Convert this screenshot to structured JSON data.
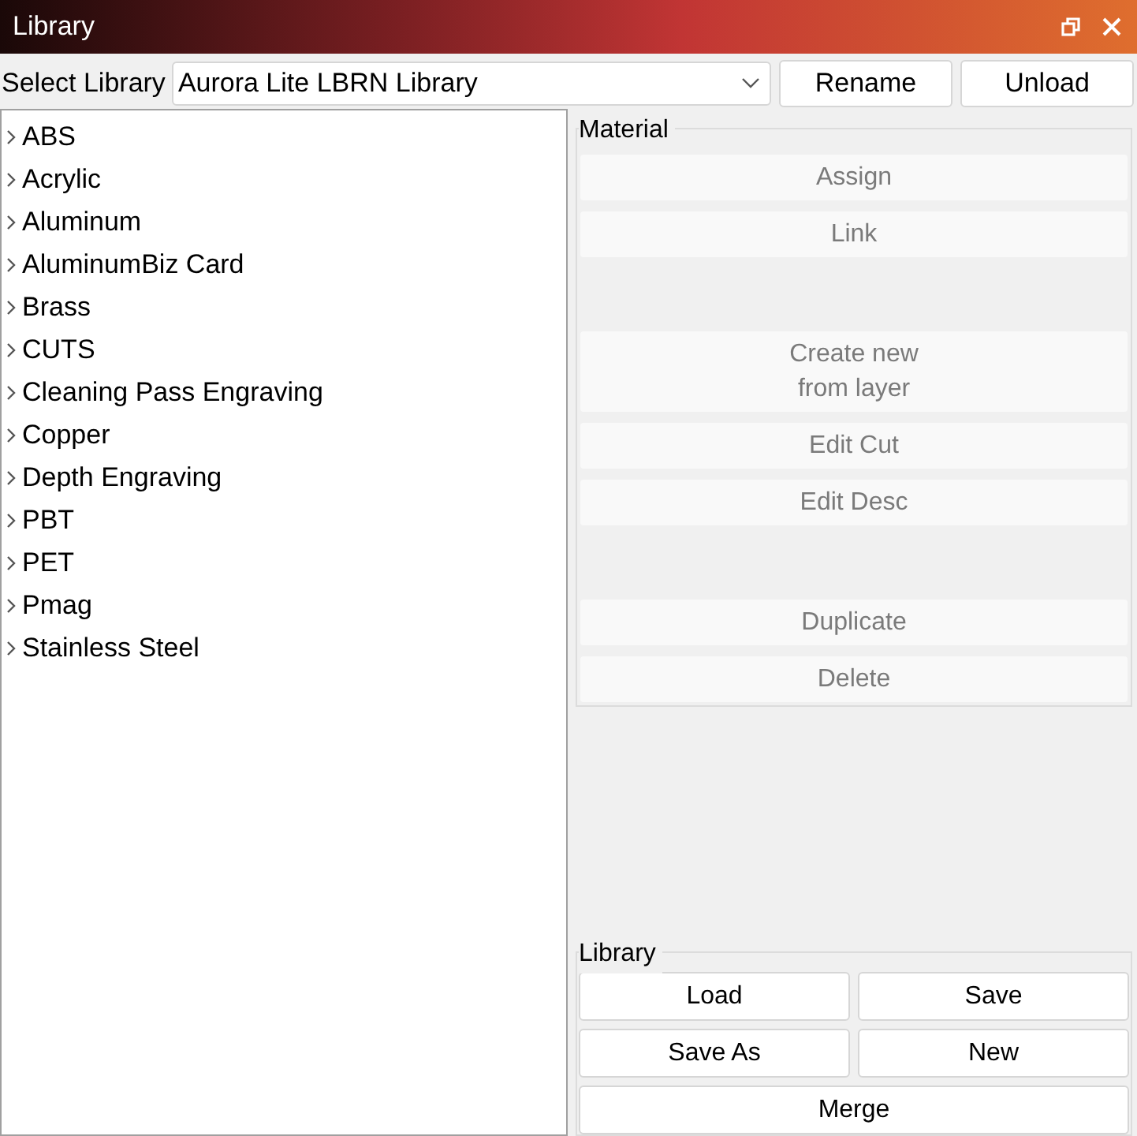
{
  "window": {
    "title": "Library"
  },
  "toolbar": {
    "label": "Select Library",
    "library": "Aurora Lite LBRN Library",
    "buttons": [
      "Rename",
      "Unload"
    ]
  },
  "tree": {
    "items": [
      {
        "label": "ABS",
        "expanded": false
      },
      {
        "label": "Acrylic",
        "expanded": false
      },
      {
        "label": "Aluminum",
        "expanded": false
      },
      {
        "label": "AluminumBiz Card",
        "expanded": false
      },
      {
        "label": "Brass",
        "expanded": false
      },
      {
        "label": "CUTS",
        "expanded": false
      },
      {
        "label": "Cleaning Pass Engraving",
        "expanded": false
      },
      {
        "label": "Copper",
        "expanded": false
      },
      {
        "label": "Depth Engraving",
        "expanded": false
      },
      {
        "label": "PBT",
        "expanded": false
      },
      {
        "label": "PET",
        "expanded": false
      },
      {
        "label": "Pmag",
        "expanded": false
      },
      {
        "label": "Stainless Steel",
        "expanded": false
      }
    ]
  },
  "material": {
    "title": "Material",
    "groups": [
      [
        {
          "label": "Assign",
          "disabled": true
        },
        {
          "label": "Link",
          "disabled": true
        }
      ],
      [
        {
          "label": "Create new\nfrom layer",
          "disabled": true
        },
        {
          "label": "Edit Cut",
          "disabled": true
        },
        {
          "label": "Edit Desc",
          "disabled": true
        }
      ],
      [
        {
          "label": "Duplicate",
          "disabled": true
        },
        {
          "label": "Delete",
          "disabled": true
        }
      ]
    ]
  },
  "library": {
    "title": "Library",
    "buttons": [
      "Load",
      "Save",
      "Save As",
      "New"
    ],
    "wide_button": "Merge"
  }
}
